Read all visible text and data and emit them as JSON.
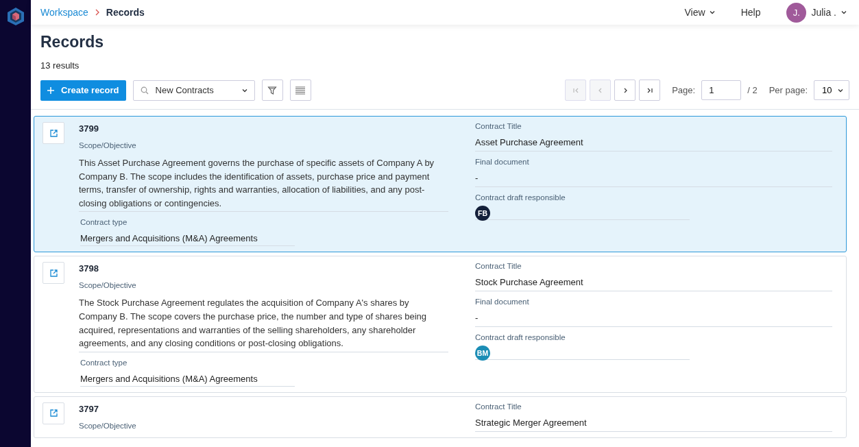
{
  "breadcrumb": [
    {
      "label": "Workspace",
      "kind": "link"
    },
    {
      "label": "Records",
      "kind": "current"
    }
  ],
  "topnav": {
    "view": "View",
    "help": "Help",
    "user_initial": "J.",
    "user_name": "Julia ."
  },
  "page_title": "Records",
  "result_count": "13 results",
  "toolbar": {
    "create_button": "Create record",
    "view_select": "New Contracts"
  },
  "pagination": {
    "page_label": "Page:",
    "page_value": "1",
    "page_total": "/ 2",
    "per_page_label": "Per page:",
    "per_page_value": "10",
    "first_disabled": true,
    "prev_disabled": true
  },
  "records": [
    {
      "id": "3799",
      "selected": true,
      "scope_label": "Scope/Objective",
      "scope": "This Asset Purchase Agreement governs the purchase of specific assets of Company A by Company B. The scope includes the identification of assets, purchase price and payment terms, transfer of ownership, rights and warranties, allocation of liabilities, and any post-closing obligations or contingencies.",
      "type_label": "Contract type",
      "type": "Mergers and Acquisitions (M&A) Agreements",
      "title_label": "Contract Title",
      "title": "Asset Purchase Agreement",
      "final_label": "Final document",
      "final": "-",
      "responsible_label": "Contract draft responsible",
      "responsible": {
        "initials": "FB",
        "color": "#14203a"
      }
    },
    {
      "id": "3798",
      "selected": false,
      "scope_label": "Scope/Objective",
      "scope": "The Stock Purchase Agreement regulates the acquisition of Company A's shares by Company B. The scope covers the purchase price, the number and type of shares being acquired, representations and warranties of the selling shareholders, any shareholder agreements, and any closing conditions or post-closing obligations.",
      "type_label": "Contract type",
      "type": "Mergers and Acquisitions (M&A) Agreements",
      "title_label": "Contract Title",
      "title": "Stock Purchase Agreement",
      "final_label": "Final document",
      "final": "-",
      "responsible_label": "Contract draft responsible",
      "responsible": {
        "initials": "BM",
        "color": "#1b8db5"
      }
    },
    {
      "id": "3797",
      "selected": false,
      "scope_label": "Scope/Objective",
      "title_label": "Contract Title",
      "title": "Strategic Merger Agreement"
    }
  ]
}
